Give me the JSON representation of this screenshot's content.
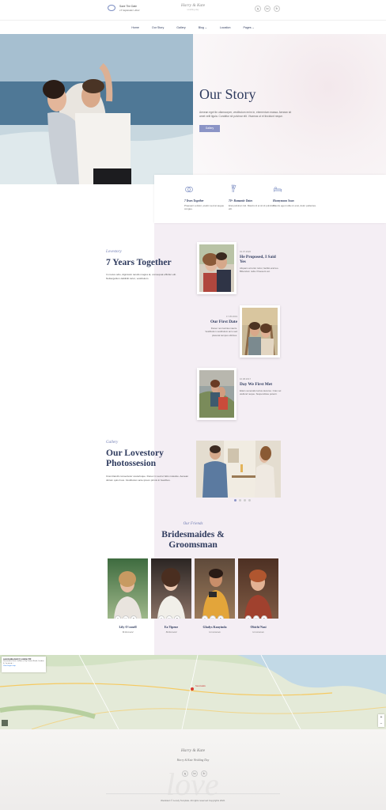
{
  "header": {
    "save_date_label": "Save The Date",
    "save_date_value": "15 September 2022",
    "logo": "Harry & Kate",
    "logo_sub": "wedding day",
    "socials": [
      "ig",
      "tw",
      "fb"
    ]
  },
  "nav": [
    "Home",
    "Our Story",
    "Gallery",
    "Blog ⌄",
    "Location",
    "Pages ⌄"
  ],
  "hero": {
    "title": "Our Story",
    "text": "Aenean eget tin ullamcorper, vestibulum enim in, elementum massa. Aenean sit amet velit ligula. Curabitur sit pulvinar elit. Vivamus ut et tincidunt neque.",
    "button": "Gallery"
  },
  "features": [
    {
      "title": "7 Years Together",
      "text": "Praesent a dolor, etudm sed at augue congue."
    },
    {
      "title": "70+ Romantic Dates",
      "text": "Erat pulvinar nisl. Mauris id et sit id pulvinar elit."
    },
    {
      "title": "Honeymoon Soon",
      "text": "Mauris eget nulla mi erat, dolor pellentes."
    }
  ],
  "lovestory": {
    "script": "Lovestory",
    "title": "7 Years Together",
    "text": "In metus odio, dignissim iaculis magna at, consequat efficitur elit. Nullavgellum dabibilit tortor, vestibulum"
  },
  "timeline": [
    {
      "date": "01.07.2020",
      "title": "He Proposed, I Said Yes",
      "text": "Aliquam at tortor tortor, facilisi erat leo. Bibendum nulla. Praesent est."
    },
    {
      "date": "17.05.2019",
      "title": "Our First Date",
      "text": "Donec non lacinia mauris. Vestibulum vestibulum arcu sed placerat tempus ultricies."
    },
    {
      "date": "10.08.2017",
      "title": "Day We First Met",
      "text": "Etiam venenatis luctus decurso. Cras vel eleifend neque. Suspendisse potenti."
    }
  ],
  "gallery": {
    "script": "Gallery",
    "title": "Our Lovestory Photossesion",
    "text": "Cras blandit consectetur scelerisque. Donec in sed ut felis molestie. Aenean dictum quis risus. Vestibulum ante ipsum primis in faucibus."
  },
  "team": {
    "script": "Our Friends",
    "title": "Bridesmaides & Groomsman",
    "members": [
      {
        "name": "Lily O'conell",
        "role": "Bridesmaid",
        "colors": [
          "#3e6b3f",
          "#9fb88a"
        ]
      },
      {
        "name": "Ea Tipene",
        "role": "Bridesmaid",
        "colors": [
          "#2b2523",
          "#8a7266"
        ]
      },
      {
        "name": "Gladys Kanyinda",
        "role": "Groomsman",
        "colors": [
          "#5f4a3b",
          "#d9a33b"
        ]
      },
      {
        "name": "Obichi Nasi",
        "role": "Groomsman",
        "colors": [
          "#4d3023",
          "#a0412e"
        ]
      }
    ]
  },
  "map": {
    "place": "sevenoaks-kent | London Kit",
    "address": "Sevenoaks Kent, London | City Centre Road, London",
    "rating": "4.1 ★★★★☆",
    "link": "View larger map",
    "marker": "Sevenoaks",
    "zoom_in": "+",
    "zoom_out": "−"
  },
  "footer": {
    "logo": "Harry & Kate",
    "tagline": "Harry & Kate Wedding Day",
    "socials": [
      "ig",
      "tw",
      "fb"
    ],
    "copyright": "Wedsitect © Lovely Template. All rights reserved Copyrights 2022."
  },
  "colors": {
    "accent": "#8b94c6",
    "navy": "#2f3b5e",
    "lavender": "#f4eef4"
  }
}
